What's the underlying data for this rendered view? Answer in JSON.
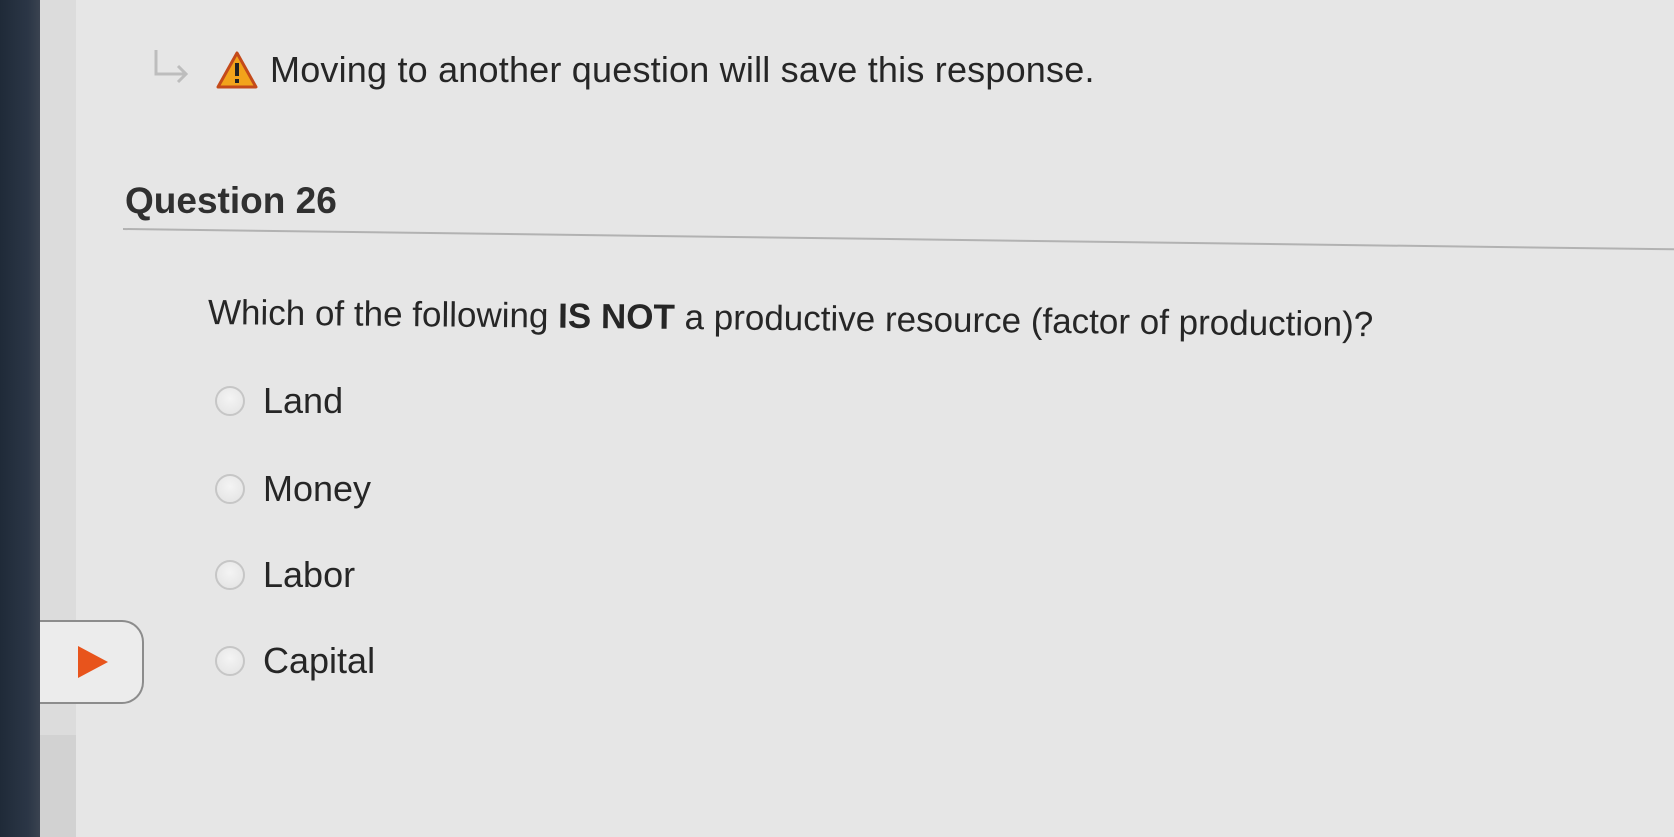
{
  "notice": {
    "text": "Moving to another question will save this response."
  },
  "question": {
    "title": "Question 26",
    "prompt_before": "Which of the following ",
    "prompt_bold": "IS NOT",
    "prompt_after": " a productive resource (factor of production)?",
    "options": [
      {
        "label": "Land",
        "selected": false
      },
      {
        "label": "Money",
        "selected": false
      },
      {
        "label": "Labor",
        "selected": false
      },
      {
        "label": "Capital",
        "selected": false
      }
    ]
  },
  "colors": {
    "warning": "#f2a31b",
    "play_accent": "#e8541c",
    "text": "#262626"
  },
  "icons": {
    "notice_arrow": "return-arrow-icon",
    "warning": "warning-icon",
    "play": "play-icon"
  }
}
